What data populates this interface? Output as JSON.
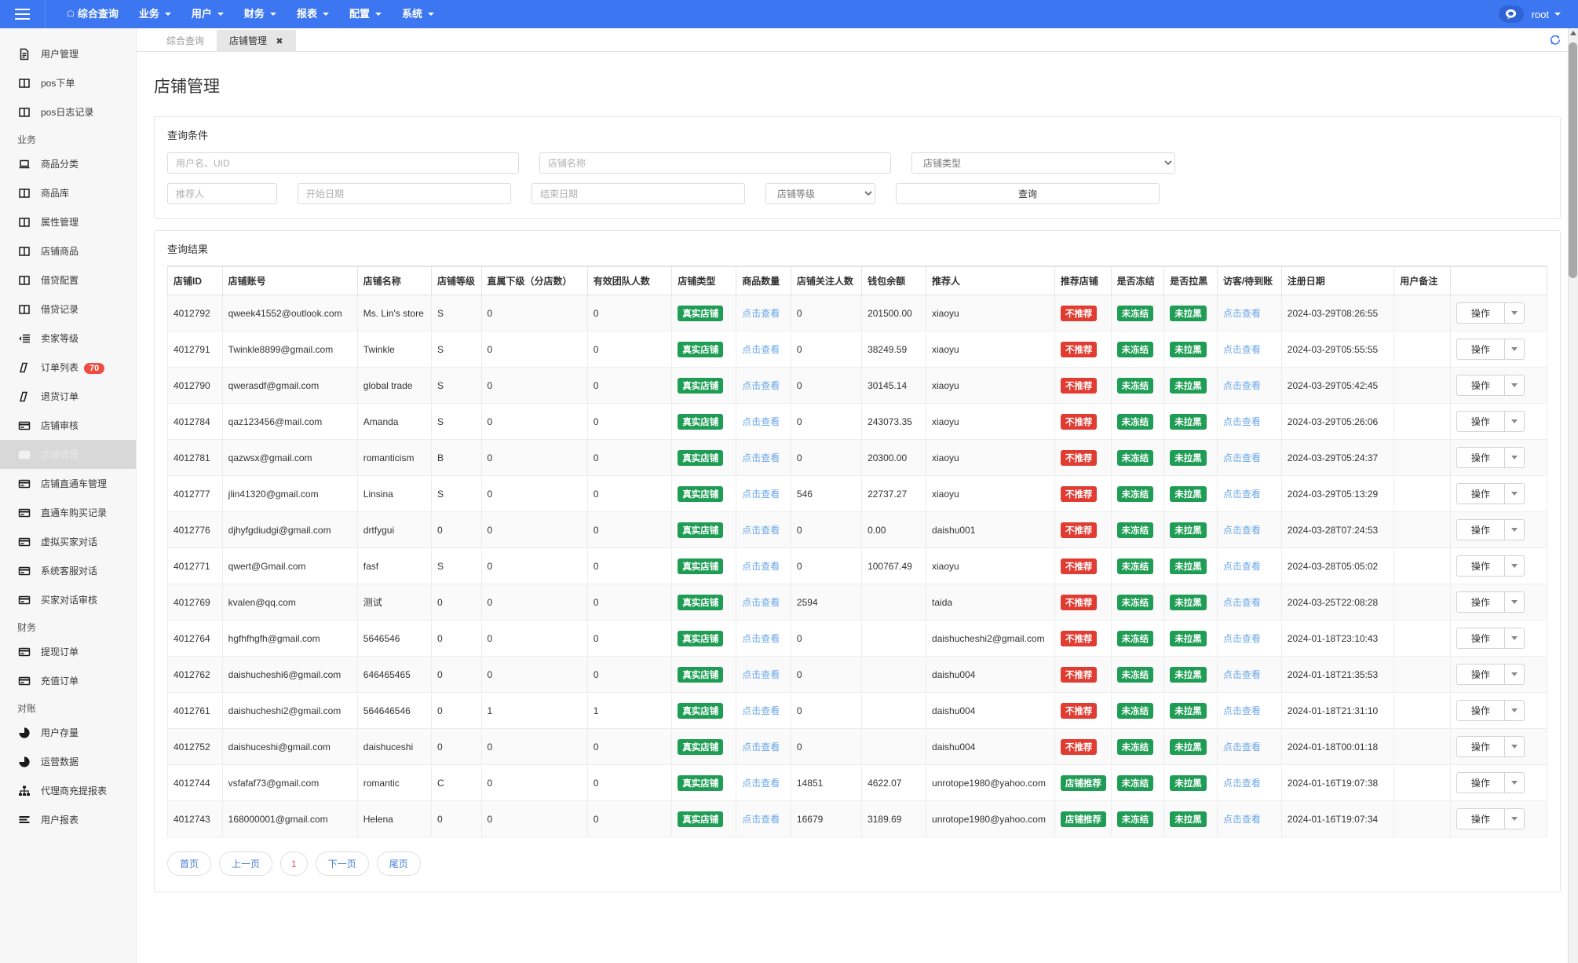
{
  "navbar": {
    "brand_icon": "hamburger-icon",
    "menu": [
      {
        "label": "综合查询",
        "has_caret": false,
        "home": true
      },
      {
        "label": "业务",
        "has_caret": true
      },
      {
        "label": "用户",
        "has_caret": true
      },
      {
        "label": "财务",
        "has_caret": true
      },
      {
        "label": "报表",
        "has_caret": true
      },
      {
        "label": "配置",
        "has_caret": true
      },
      {
        "label": "系统",
        "has_caret": true
      }
    ],
    "user": "root",
    "accent_color": "#3c76f0"
  },
  "sidebar": {
    "items": [
      {
        "label": "用户管理",
        "icon": "document-icon",
        "type": "item"
      },
      {
        "label": "pos下单",
        "icon": "columns-icon",
        "type": "item"
      },
      {
        "label": "pos日志记录",
        "icon": "columns-icon",
        "type": "item"
      },
      {
        "label": "业务",
        "type": "group"
      },
      {
        "label": "商品分类",
        "icon": "laptop-icon",
        "type": "item"
      },
      {
        "label": "商品库",
        "icon": "columns-icon",
        "type": "item"
      },
      {
        "label": "属性管理",
        "icon": "columns-icon",
        "type": "item"
      },
      {
        "label": "店铺商品",
        "icon": "columns-icon",
        "type": "item"
      },
      {
        "label": "借贷配置",
        "icon": "columns-icon",
        "type": "item"
      },
      {
        "label": "借贷记录",
        "icon": "columns-icon",
        "type": "item"
      },
      {
        "label": "卖家等级",
        "icon": "list-indent-icon",
        "type": "item"
      },
      {
        "label": "订单列表",
        "icon": "slash-icon",
        "type": "item",
        "badge": "70"
      },
      {
        "label": "退货订单",
        "icon": "slash-icon",
        "type": "item"
      },
      {
        "label": "店铺审核",
        "icon": "card-icon",
        "type": "item"
      },
      {
        "label": "店铺管理",
        "icon": "card-icon",
        "type": "item",
        "active": true
      },
      {
        "label": "店铺直通车管理",
        "icon": "card-icon",
        "type": "item"
      },
      {
        "label": "直通车购买记录",
        "icon": "card-icon",
        "type": "item"
      },
      {
        "label": "虚拟买家对话",
        "icon": "card-icon",
        "type": "item"
      },
      {
        "label": "系统客服对话",
        "icon": "card-icon",
        "type": "item"
      },
      {
        "label": "买家对话审核",
        "icon": "card-icon",
        "type": "item"
      },
      {
        "label": "财务",
        "type": "group"
      },
      {
        "label": "提现订单",
        "icon": "card-icon",
        "type": "item"
      },
      {
        "label": "充值订单",
        "icon": "card-icon",
        "type": "item"
      },
      {
        "label": "对账",
        "type": "group"
      },
      {
        "label": "用户存量",
        "icon": "pie-icon",
        "type": "item"
      },
      {
        "label": "运营数据",
        "icon": "pie-icon",
        "type": "item"
      },
      {
        "label": "代理商充提报表",
        "icon": "sitemap-icon",
        "type": "item"
      },
      {
        "label": "用户报表",
        "icon": "bars-icon",
        "type": "item"
      }
    ]
  },
  "tabs": {
    "inactive_label": "综合查询",
    "active_label": "店铺管理",
    "close_glyph": "✖",
    "refresh_icon": "refresh-icon"
  },
  "page": {
    "title": "店铺管理"
  },
  "search_panel": {
    "title": "查询条件",
    "username_uid_placeholder": "用户名、UID",
    "shop_name_placeholder": "店铺名称",
    "shop_type_selected": "店铺类型",
    "referrer_placeholder": "推荐人",
    "start_date_placeholder": "开始日期",
    "end_date_placeholder": "结束日期",
    "shop_level_selected": "店铺等级",
    "query_button": "查询"
  },
  "result_panel": {
    "title": "查询结果",
    "columns": [
      "店铺ID",
      "店铺账号",
      "店铺名称",
      "店铺等级",
      "直属下级（分店数）",
      "有效团队人数",
      "店铺类型",
      "商品数量",
      "店铺关注人数",
      "钱包余额",
      "推荐人",
      "推荐店铺",
      "是否冻结",
      "是否拉黑",
      "访客/待到账",
      "注册日期",
      "用户备注",
      ""
    ],
    "view_link_label": "点击查看",
    "operation_label": "操作",
    "rows": [
      {
        "id": "4012792",
        "account": "qweek41552@outlook.com",
        "name": "Ms. Lin's store",
        "level": "S",
        "sub": "0",
        "team": "0",
        "type": "真实店铺",
        "goods": "点击查看",
        "followers": "0",
        "wallet": "201500.00",
        "referrer": "xiaoyu",
        "recommend": "不推荐",
        "recommend_kind": "red",
        "frozen": "未冻结",
        "black": "未拉黑",
        "visitor": "点击查看",
        "regdate": "2024-03-29T08:26:55",
        "remark": ""
      },
      {
        "id": "4012791",
        "account": "Twinkle8899@gmail.com",
        "name": "Twinkle",
        "level": "S",
        "sub": "0",
        "team": "0",
        "type": "真实店铺",
        "goods": "点击查看",
        "followers": "0",
        "wallet": "38249.59",
        "referrer": "xiaoyu",
        "recommend": "不推荐",
        "recommend_kind": "red",
        "frozen": "未冻结",
        "black": "未拉黑",
        "visitor": "点击查看",
        "regdate": "2024-03-29T05:55:55",
        "remark": ""
      },
      {
        "id": "4012790",
        "account": "qwerasdf@gmail.com",
        "name": "global trade",
        "level": "S",
        "sub": "0",
        "team": "0",
        "type": "真实店铺",
        "goods": "点击查看",
        "followers": "0",
        "wallet": "30145.14",
        "referrer": "xiaoyu",
        "recommend": "不推荐",
        "recommend_kind": "red",
        "frozen": "未冻结",
        "black": "未拉黑",
        "visitor": "点击查看",
        "regdate": "2024-03-29T05:42:45",
        "remark": ""
      },
      {
        "id": "4012784",
        "account": "qaz123456@mail.com",
        "name": "Amanda",
        "level": "S",
        "sub": "0",
        "team": "0",
        "type": "真实店铺",
        "goods": "点击查看",
        "followers": "0",
        "wallet": "243073.35",
        "referrer": "xiaoyu",
        "recommend": "不推荐",
        "recommend_kind": "red",
        "frozen": "未冻结",
        "black": "未拉黑",
        "visitor": "点击查看",
        "regdate": "2024-03-29T05:26:06",
        "remark": ""
      },
      {
        "id": "4012781",
        "account": "qazwsx@gmail.com",
        "name": "romanticism",
        "level": "B",
        "sub": "0",
        "team": "0",
        "type": "真实店铺",
        "goods": "点击查看",
        "followers": "0",
        "wallet": "20300.00",
        "referrer": "xiaoyu",
        "recommend": "不推荐",
        "recommend_kind": "red",
        "frozen": "未冻结",
        "black": "未拉黑",
        "visitor": "点击查看",
        "regdate": "2024-03-29T05:24:37",
        "remark": ""
      },
      {
        "id": "4012777",
        "account": "jlin41320@gmail.com",
        "name": "Linsina",
        "level": "S",
        "sub": "0",
        "team": "0",
        "type": "真实店铺",
        "goods": "点击查看",
        "followers": "546",
        "wallet": "22737.27",
        "referrer": "xiaoyu",
        "recommend": "不推荐",
        "recommend_kind": "red",
        "frozen": "未冻结",
        "black": "未拉黑",
        "visitor": "点击查看",
        "regdate": "2024-03-29T05:13:29",
        "remark": ""
      },
      {
        "id": "4012776",
        "account": "djhyfgdiudgi@gmail.com",
        "name": "drtfygui",
        "level": "0",
        "sub": "0",
        "team": "0",
        "type": "真实店铺",
        "goods": "点击查看",
        "followers": "0",
        "wallet": "0.00",
        "referrer": "daishu001",
        "recommend": "不推荐",
        "recommend_kind": "red",
        "frozen": "未冻结",
        "black": "未拉黑",
        "visitor": "点击查看",
        "regdate": "2024-03-28T07:24:53",
        "remark": ""
      },
      {
        "id": "4012771",
        "account": "qwert@Gmail.com",
        "name": "fasf",
        "level": "S",
        "sub": "0",
        "team": "0",
        "type": "真实店铺",
        "goods": "点击查看",
        "followers": "0",
        "wallet": "100767.49",
        "referrer": "xiaoyu",
        "recommend": "不推荐",
        "recommend_kind": "red",
        "frozen": "未冻结",
        "black": "未拉黑",
        "visitor": "点击查看",
        "regdate": "2024-03-28T05:05:02",
        "remark": ""
      },
      {
        "id": "4012769",
        "account": "kvalen@qq.com",
        "name": "测试",
        "level": "0",
        "sub": "0",
        "team": "0",
        "type": "真实店铺",
        "goods": "点击查看",
        "followers": "2594",
        "wallet": "",
        "referrer": "taida",
        "recommend": "不推荐",
        "recommend_kind": "red",
        "frozen": "未冻结",
        "black": "未拉黑",
        "visitor": "点击查看",
        "regdate": "2024-03-25T22:08:28",
        "remark": ""
      },
      {
        "id": "4012764",
        "account": "hgfhfhgfh@gmail.com",
        "name": "5646546",
        "level": "0",
        "sub": "0",
        "team": "0",
        "type": "真实店铺",
        "goods": "点击查看",
        "followers": "0",
        "wallet": "",
        "referrer": "daishucheshi2@gmail.com",
        "recommend": "不推荐",
        "recommend_kind": "red",
        "frozen": "未冻结",
        "black": "未拉黑",
        "visitor": "点击查看",
        "regdate": "2024-01-18T23:10:43",
        "remark": ""
      },
      {
        "id": "4012762",
        "account": "daishucheshi6@gmail.com",
        "name": "646465465",
        "level": "0",
        "sub": "0",
        "team": "0",
        "type": "真实店铺",
        "goods": "点击查看",
        "followers": "0",
        "wallet": "",
        "referrer": "daishu004",
        "recommend": "不推荐",
        "recommend_kind": "red",
        "frozen": "未冻结",
        "black": "未拉黑",
        "visitor": "点击查看",
        "regdate": "2024-01-18T21:35:53",
        "remark": ""
      },
      {
        "id": "4012761",
        "account": "daishucheshi2@gmail.com",
        "name": "564646546",
        "level": "0",
        "sub": "1",
        "team": "1",
        "type": "真实店铺",
        "goods": "点击查看",
        "followers": "0",
        "wallet": "",
        "referrer": "daishu004",
        "recommend": "不推荐",
        "recommend_kind": "red",
        "frozen": "未冻结",
        "black": "未拉黑",
        "visitor": "点击查看",
        "regdate": "2024-01-18T21:31:10",
        "remark": ""
      },
      {
        "id": "4012752",
        "account": "daishuceshi@gmail.com",
        "name": "daishuceshi",
        "level": "0",
        "sub": "0",
        "team": "0",
        "type": "真实店铺",
        "goods": "点击查看",
        "followers": "0",
        "wallet": "",
        "referrer": "daishu004",
        "recommend": "不推荐",
        "recommend_kind": "red",
        "frozen": "未冻结",
        "black": "未拉黑",
        "visitor": "点击查看",
        "regdate": "2024-01-18T00:01:18",
        "remark": ""
      },
      {
        "id": "4012744",
        "account": "vsfafaf73@gmail.com",
        "name": "romantic",
        "level": "C",
        "sub": "0",
        "team": "0",
        "type": "真实店铺",
        "goods": "点击查看",
        "followers": "14851",
        "wallet": "4622.07",
        "referrer": "unrotope1980@yahoo.com",
        "recommend": "店铺推荐",
        "recommend_kind": "green",
        "frozen": "未冻结",
        "black": "未拉黑",
        "visitor": "点击查看",
        "regdate": "2024-01-16T19:07:38",
        "remark": ""
      },
      {
        "id": "4012743",
        "account": "168000001@gmail.com",
        "name": "Helena",
        "level": "0",
        "sub": "0",
        "team": "0",
        "type": "真实店铺",
        "goods": "点击查看",
        "followers": "16679",
        "wallet": "3189.69",
        "referrer": "unrotope1980@yahoo.com",
        "recommend": "店铺推荐",
        "recommend_kind": "green",
        "frozen": "未冻结",
        "black": "未拉黑",
        "visitor": "点击查看",
        "regdate": "2024-01-16T19:07:34",
        "remark": ""
      }
    ]
  },
  "pagination": {
    "first": "首页",
    "prev": "上一页",
    "current": "1",
    "next": "下一页",
    "last": "尾页"
  },
  "colors": {
    "accent": "#3c76f0",
    "green": "#1f9d55",
    "red": "#e13c32",
    "link": "#6ca8e8"
  }
}
